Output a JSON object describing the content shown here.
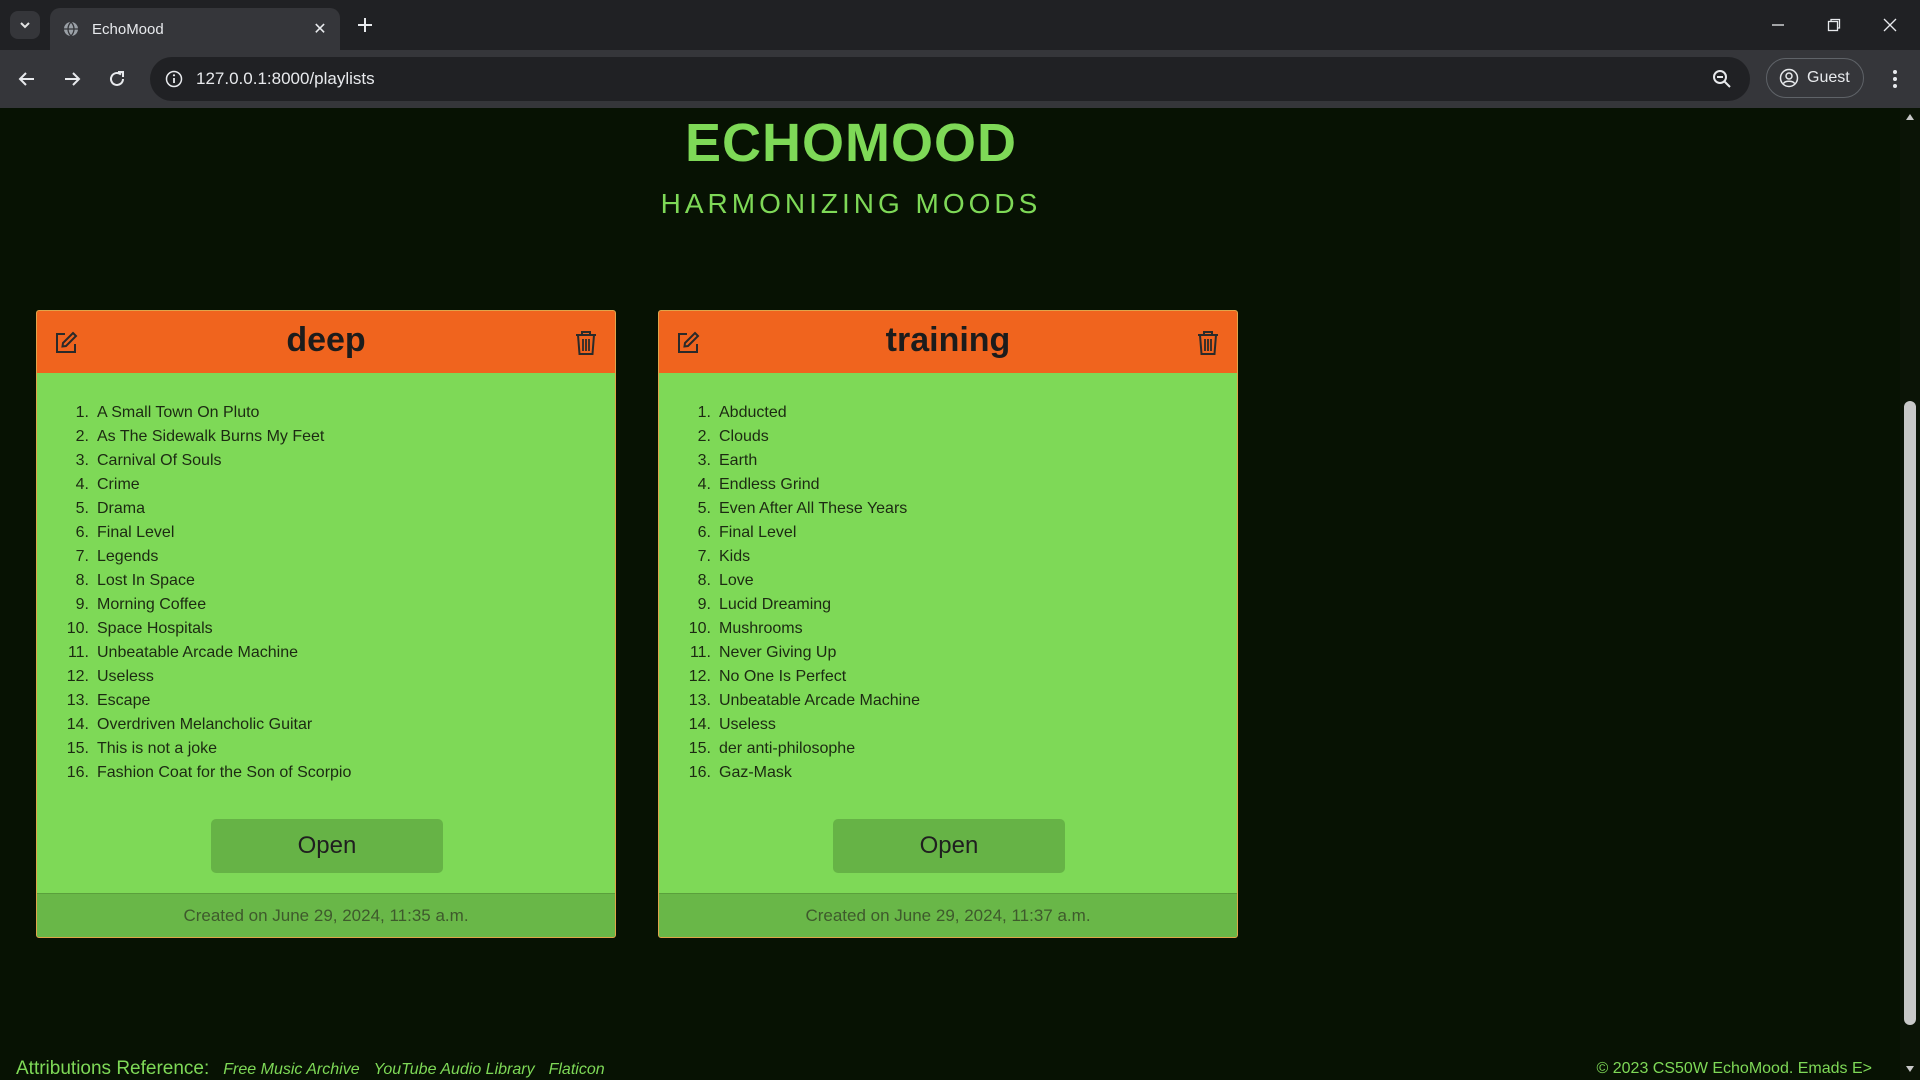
{
  "browser": {
    "tab_title": "EchoMood",
    "url": "127.0.0.1:8000/playlists",
    "profile_label": "Guest"
  },
  "header": {
    "title": "ECHOMOOD",
    "subtitle": "HARMONIZING MOODS"
  },
  "playlists": [
    {
      "name": "deep",
      "songs": [
        {
          "num": "1.",
          "title": "A Small Town On Pluto"
        },
        {
          "num": "2.",
          "title": "As The Sidewalk Burns My Feet"
        },
        {
          "num": "3.",
          "title": "Carnival Of Souls"
        },
        {
          "num": "4.",
          "title": "Crime"
        },
        {
          "num": "5.",
          "title": "Drama"
        },
        {
          "num": "6.",
          "title": "Final Level"
        },
        {
          "num": "7.",
          "title": "Legends"
        },
        {
          "num": "8.",
          "title": "Lost In Space"
        },
        {
          "num": "9.",
          "title": "Morning Coffee"
        },
        {
          "num": "10.",
          "title": "Space Hospitals"
        },
        {
          "num": "11.",
          "title": "Unbeatable Arcade Machine"
        },
        {
          "num": "12.",
          "title": "Useless"
        },
        {
          "num": "13.",
          "title": "Escape"
        },
        {
          "num": "14.",
          "title": "Overdriven Melancholic Guitar"
        },
        {
          "num": "15.",
          "title": "This is not a joke"
        },
        {
          "num": "16.",
          "title": "Fashion Coat for the Son of Scorpio"
        }
      ],
      "open_label": "Open",
      "created": "Created on June 29, 2024, 11:35 a.m."
    },
    {
      "name": "training",
      "songs": [
        {
          "num": "1.",
          "title": "Abducted"
        },
        {
          "num": "2.",
          "title": "Clouds"
        },
        {
          "num": "3.",
          "title": "Earth"
        },
        {
          "num": "4.",
          "title": "Endless Grind"
        },
        {
          "num": "5.",
          "title": "Even After All These Years"
        },
        {
          "num": "6.",
          "title": "Final Level"
        },
        {
          "num": "7.",
          "title": "Kids"
        },
        {
          "num": "8.",
          "title": "Love"
        },
        {
          "num": "9.",
          "title": "Lucid Dreaming"
        },
        {
          "num": "10.",
          "title": "Mushrooms"
        },
        {
          "num": "11.",
          "title": "Never Giving Up"
        },
        {
          "num": "12.",
          "title": "No One Is Perfect"
        },
        {
          "num": "13.",
          "title": "Unbeatable Arcade Machine"
        },
        {
          "num": "14.",
          "title": "Useless"
        },
        {
          "num": "15.",
          "title": "der anti-philosophe"
        },
        {
          "num": "16.",
          "title": "Gaz-Mask"
        }
      ],
      "open_label": "Open",
      "created": "Created on June 29, 2024, 11:37 a.m."
    }
  ],
  "footer": {
    "attributions_label": "Attributions Reference:",
    "links": [
      "Free Music Archive",
      "YouTube Audio Library",
      "Flaticon"
    ],
    "copyright": "© 2023 CS50W EchoMood. Emads  E>"
  },
  "colors": {
    "background": "#071203",
    "accent_green": "#7ed957",
    "card_header_orange": "#f0641e"
  }
}
